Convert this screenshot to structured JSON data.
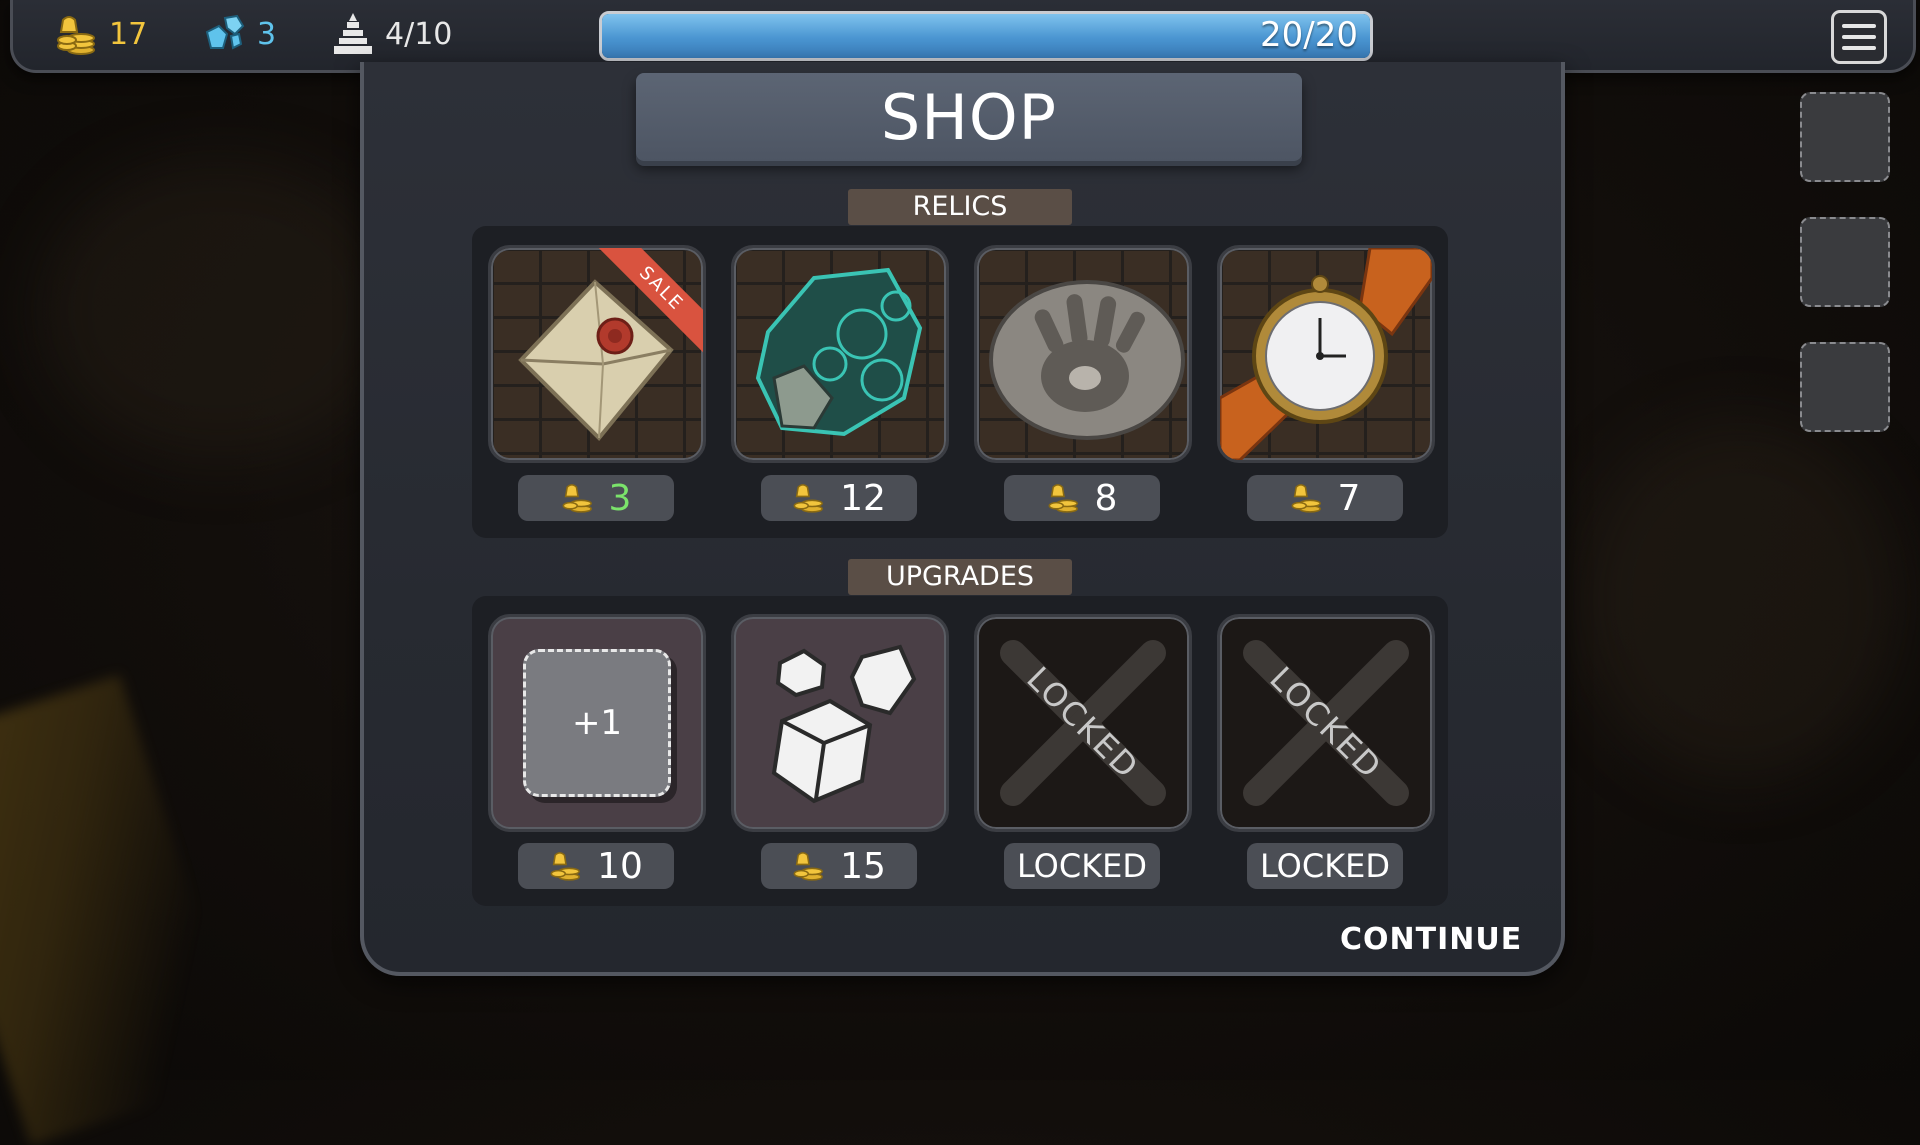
{
  "stats": {
    "gold": "17",
    "gems": "3",
    "floor": "4/10"
  },
  "health": {
    "text": "20/20",
    "current": 20,
    "max": 20
  },
  "title": "SHOP",
  "sections": {
    "relics_label": "RELICS",
    "upgrades_label": "UPGRADES"
  },
  "relics": [
    {
      "icon": "envelope-icon",
      "price": "3",
      "sale_label": "SALE"
    },
    {
      "icon": "green-stone-icon",
      "price": "12"
    },
    {
      "icon": "handprint-stone-icon",
      "price": "8"
    },
    {
      "icon": "wristwatch-icon",
      "price": "7"
    }
  ],
  "upgrades": [
    {
      "icon": "extra-slot-icon",
      "slot_label": "+1",
      "price": "10"
    },
    {
      "icon": "dice-icon",
      "price": "15"
    },
    {
      "icon": "locked-x-icon",
      "overlay": "LOCKED",
      "price": "LOCKED"
    },
    {
      "icon": "locked-x-icon",
      "overlay": "LOCKED",
      "price": "LOCKED"
    }
  ],
  "continue_label": "CONTINUE",
  "colors": {
    "gold": "#f2c53d",
    "gem": "#5fc3ec",
    "sale_price": "#7be36b",
    "hp_fill": "#4a95d1",
    "label_bg": "#5a4e46"
  }
}
